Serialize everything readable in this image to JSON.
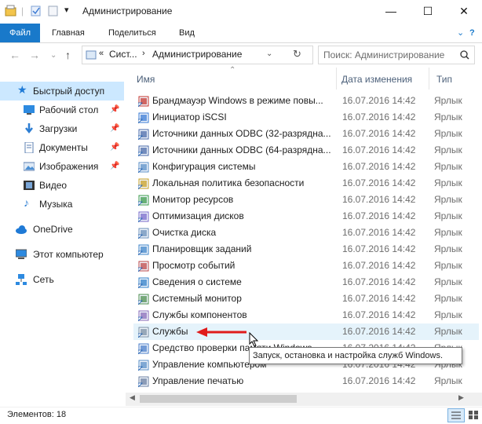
{
  "window": {
    "title": "Администрирование",
    "minimize_icon": "minimize-icon",
    "maximize_icon": "maximize-icon",
    "close_icon": "close-icon"
  },
  "ribbon": {
    "tabs": [
      "Файл",
      "Главная",
      "Поделиться",
      "Вид"
    ],
    "help_icon": "help-icon",
    "accent": "#1979ca"
  },
  "address": {
    "prefix": "«",
    "crumb1": "Сист...",
    "crumb2": "Администрирование",
    "search_placeholder": "Поиск: Администрирование"
  },
  "nav": {
    "items": [
      {
        "label": "Быстрый доступ",
        "icon": "star-icon",
        "pinned": false
      },
      {
        "label": "Рабочий стол",
        "icon": "desktop-icon",
        "pinned": true
      },
      {
        "label": "Загрузки",
        "icon": "download-icon",
        "pinned": true
      },
      {
        "label": "Документы",
        "icon": "documents-icon",
        "pinned": true
      },
      {
        "label": "Изображения",
        "icon": "pictures-icon",
        "pinned": true
      },
      {
        "label": "Видео",
        "icon": "video-icon",
        "pinned": false
      },
      {
        "label": "Музыка",
        "icon": "music-icon",
        "pinned": false
      },
      {
        "label": "OneDrive",
        "icon": "cloud-icon",
        "pinned": false
      },
      {
        "label": "Этот компьютер",
        "icon": "computer-icon",
        "pinned": false
      },
      {
        "label": "Сеть",
        "icon": "network-icon",
        "pinned": false
      }
    ]
  },
  "columns": {
    "name": "Имя",
    "date": "Дата изменения",
    "type": "Тип"
  },
  "files": [
    {
      "name": "Брандмауэр Windows в режиме повы...",
      "date": "16.07.2016 14:42",
      "type": "Ярлык"
    },
    {
      "name": "Инициатор iSCSI",
      "date": "16.07.2016 14:42",
      "type": "Ярлык"
    },
    {
      "name": "Источники данных ODBC (32-разрядна...",
      "date": "16.07.2016 14:42",
      "type": "Ярлык"
    },
    {
      "name": "Источники данных ODBC (64-разрядна...",
      "date": "16.07.2016 14:42",
      "type": "Ярлык"
    },
    {
      "name": "Конфигурация системы",
      "date": "16.07.2016 14:42",
      "type": "Ярлык"
    },
    {
      "name": "Локальная политика безопасности",
      "date": "16.07.2016 14:42",
      "type": "Ярлык"
    },
    {
      "name": "Монитор ресурсов",
      "date": "16.07.2016 14:42",
      "type": "Ярлык"
    },
    {
      "name": "Оптимизация дисков",
      "date": "16.07.2016 14:42",
      "type": "Ярлык"
    },
    {
      "name": "Очистка диска",
      "date": "16.07.2016 14:42",
      "type": "Ярлык"
    },
    {
      "name": "Планировщик заданий",
      "date": "16.07.2016 14:42",
      "type": "Ярлык"
    },
    {
      "name": "Просмотр событий",
      "date": "16.07.2016 14:42",
      "type": "Ярлык"
    },
    {
      "name": "Сведения о системе",
      "date": "16.07.2016 14:42",
      "type": "Ярлык"
    },
    {
      "name": "Системный монитор",
      "date": "16.07.2016 14:42",
      "type": "Ярлык"
    },
    {
      "name": "Службы компонентов",
      "date": "16.07.2016 14:42",
      "type": "Ярлык"
    },
    {
      "name": "Службы",
      "date": "16.07.2016 14:42",
      "type": "Ярлык",
      "selected": true
    },
    {
      "name": "Средство проверки памяти Windows",
      "date": "16.07.2016 14:42",
      "type": "Ярлык"
    },
    {
      "name": "Управление компьютером",
      "date": "16.07.2016 14:42",
      "type": "Ярлык"
    },
    {
      "name": "Управление печатью",
      "date": "16.07.2016 14:42",
      "type": "Ярлык"
    }
  ],
  "tooltip": "Запуск, остановка и настройка служб Windows.",
  "status": {
    "items_count": "Элементов: 18"
  }
}
